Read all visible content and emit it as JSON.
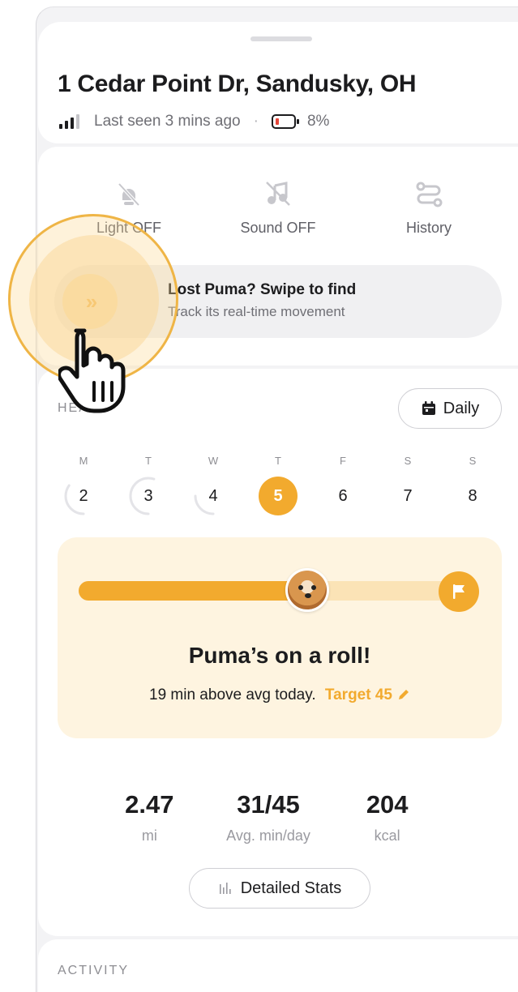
{
  "header": {
    "address": "1 Cedar Point Dr, Sandusky, OH",
    "last_seen": "Last seen 3 mins ago",
    "separator": "·",
    "battery": "8%"
  },
  "controls": [
    {
      "label": "Light OFF",
      "icon": "light-off-icon"
    },
    {
      "label": "Sound OFF",
      "icon": "sound-off-icon"
    },
    {
      "label": "History",
      "icon": "history-icon"
    }
  ],
  "swipe": {
    "title": "Lost Puma? Swipe to find",
    "subtitle": "Track its real-time movement",
    "knob_glyph": "»"
  },
  "health": {
    "section_label": "HEA",
    "period_button": "Daily",
    "days": [
      {
        "weekday": "M",
        "date": "2",
        "progress": 0.35
      },
      {
        "weekday": "T",
        "date": "3",
        "progress": 0.55
      },
      {
        "weekday": "W",
        "date": "4",
        "progress": 0.25
      },
      {
        "weekday": "T",
        "date": "5",
        "progress": 1.0,
        "today": true
      },
      {
        "weekday": "F",
        "date": "6",
        "progress": 0
      },
      {
        "weekday": "S",
        "date": "7",
        "progress": 0
      },
      {
        "weekday": "S",
        "date": "8",
        "progress": 0
      }
    ],
    "goal_progress": 0.6,
    "headline": "Puma’s on a roll!",
    "summary": "19 min above avg today.",
    "target": "Target 45",
    "stats": [
      {
        "value": "2.47",
        "unit": "mi"
      },
      {
        "value": "31/45",
        "unit": "Avg. min/day"
      },
      {
        "value": "204",
        "unit": "kcal"
      }
    ],
    "detail_button": "Detailed Stats"
  },
  "activity": {
    "section_label": "ACTIVITY"
  },
  "colors": {
    "accent": "#f2aa2e",
    "accent_light": "#fbe3b6",
    "card_tint": "#fef4e0",
    "battery_low": "#e5463a"
  }
}
